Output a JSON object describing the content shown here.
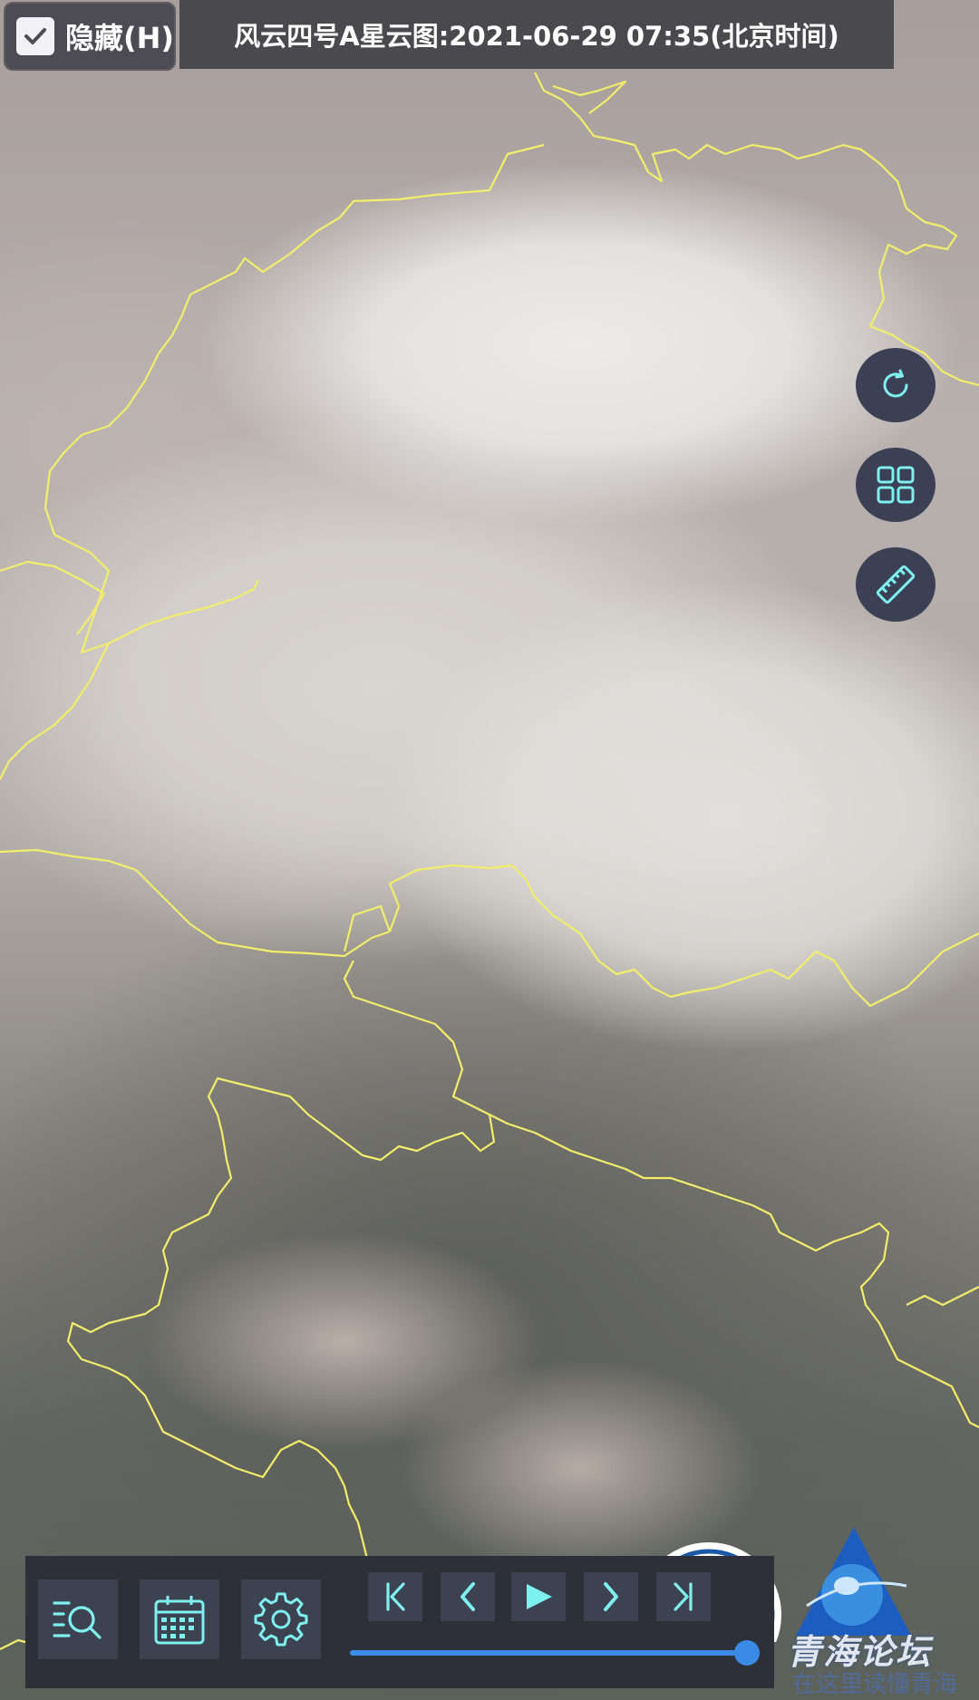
{
  "hide_toggle": {
    "label": "隐藏(H)",
    "checked": true
  },
  "title": "风云四号A星云图:2021-06-29 07:35(北京时间)",
  "side_buttons": [
    {
      "name": "refresh",
      "icon": "refresh-icon"
    },
    {
      "name": "grid",
      "icon": "grid-icon"
    },
    {
      "name": "ruler",
      "icon": "ruler-icon"
    }
  ],
  "toolbar": {
    "tools": [
      "list-search-icon",
      "calendar-icon",
      "gear-icon"
    ],
    "playback": [
      "skip-first-icon",
      "previous-icon",
      "play-icon",
      "next-icon",
      "skip-last-icon"
    ],
    "timeline_position": 1.0
  },
  "watermark": {
    "forum_name": "青海论坛",
    "slogan": "在这里读懂青海"
  },
  "colors": {
    "accent": "#7ff0f0",
    "border_lines": "#f2ee6a",
    "slider": "#3a8be6",
    "panel": "#2d3038"
  }
}
